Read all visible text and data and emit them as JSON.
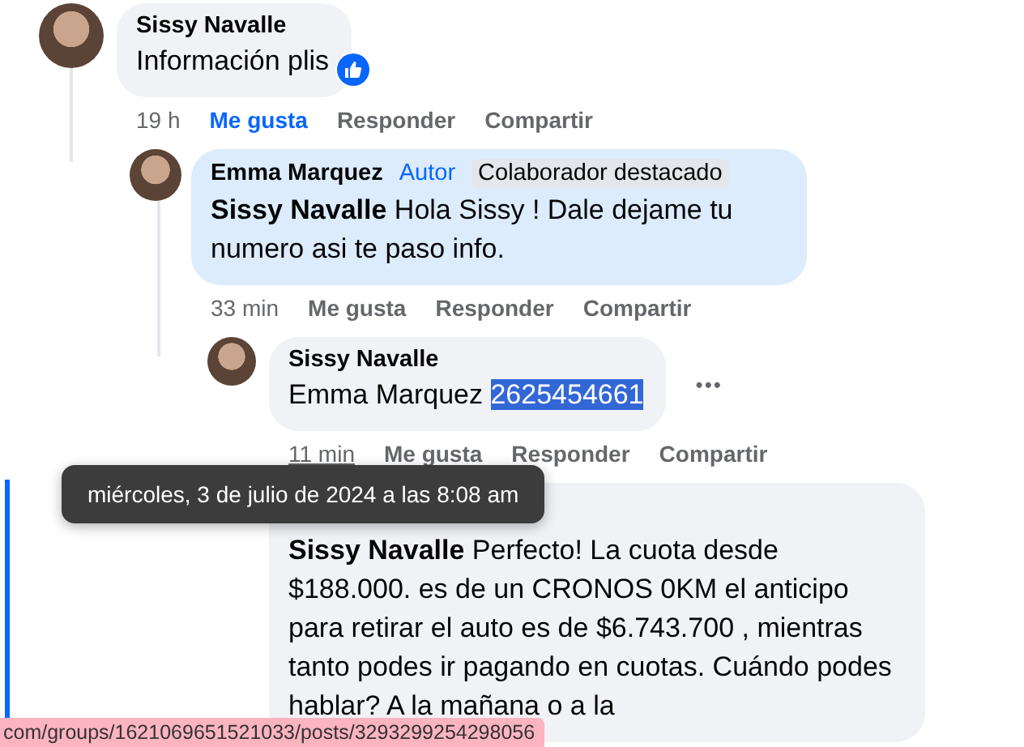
{
  "comments": [
    {
      "author": "Sissy Navalle",
      "body": "Información plis",
      "highlighted": false,
      "reacted": true,
      "actions": {
        "time": "19 h",
        "time_hovered": false,
        "like": "Me gusta",
        "liked": true,
        "reply": "Responder",
        "share": "Compartir"
      },
      "children": [
        {
          "author": "Emma Marquez",
          "badges": [
            {
              "label": "Autor",
              "kind": "role"
            },
            {
              "label": "Colaborador destacado",
              "kind": "tag"
            }
          ],
          "body": "**Sissy Navalle** Hola Sissy ! Dale dejame tu numero asi te paso info.",
          "highlighted": true,
          "actions": {
            "time": "33 min",
            "time_hovered": false,
            "like": "Me gusta",
            "liked": false,
            "reply": "Responder",
            "share": "Compartir"
          },
          "children": [
            {
              "author": "Sissy Navalle",
              "body": "Emma Marquez",
              "selected_part": "2625454661",
              "highlighted": false,
              "actions": {
                "time": "11 min",
                "time_hovered": true,
                "like": "Me gusta",
                "liked": false,
                "reply": "Responder",
                "share": "Compartir"
              },
              "more_button": "•••"
            },
            {
              "body": "**Sissy Navalle** Perfecto! La cuota desde $188.000. es de un CRONOS 0KM el anticipo para retirar el auto es de $6.743.700 , mientras tanto podes ir pagando en cuotas. Cuándo podes hablar? A la mañana o a la",
              "highlighted": false,
              "focused": true
            }
          ]
        }
      ]
    }
  ],
  "tooltip": "miércoles, 3 de julio de 2024 a las 8:08 am",
  "status_bar": "com/groups/1621069651521033/posts/3293299254298056"
}
